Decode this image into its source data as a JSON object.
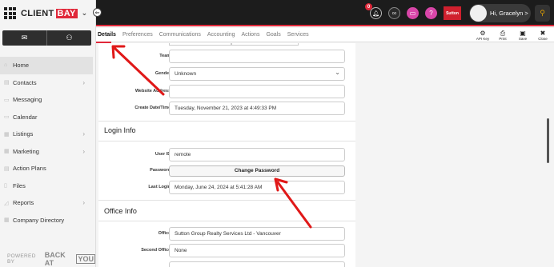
{
  "brand": {
    "name_part1": "CLIENT",
    "name_part2": "BAY"
  },
  "sidebar": {
    "tools": [
      {
        "icon": "envelope-icon",
        "glyph": "✉"
      },
      {
        "icon": "add-person-icon",
        "glyph": "👤"
      }
    ],
    "items": [
      {
        "label": "Home",
        "icon": "home-icon",
        "active": true,
        "has_arrow": false
      },
      {
        "label": "Contacts",
        "icon": "contacts-icon",
        "has_arrow": true
      },
      {
        "label": "Messaging",
        "icon": "chat-icon",
        "has_arrow": false
      },
      {
        "label": "Calendar",
        "icon": "calendar-icon",
        "has_arrow": false
      },
      {
        "label": "Listings",
        "icon": "listings-icon",
        "has_arrow": true
      },
      {
        "label": "Marketing",
        "icon": "marketing-icon",
        "has_arrow": true
      },
      {
        "label": "Action Plans",
        "icon": "action-plans-icon",
        "has_arrow": false
      },
      {
        "label": "Files",
        "icon": "files-icon",
        "has_arrow": false
      },
      {
        "label": "Reports",
        "icon": "reports-icon",
        "has_arrow": true
      },
      {
        "label": "Company Directory",
        "icon": "directory-icon",
        "has_arrow": false
      }
    ],
    "powered_by": "POWERED BY",
    "powered_brand": "BACK AT",
    "powered_brand_box": "YOU"
  },
  "topbar": {
    "notification_count": "0",
    "sutton_label": "Sutton",
    "user_greeting": "Hi, Gracelyn >"
  },
  "tabs": [
    "Details",
    "Preferences",
    "Communications",
    "Accounting",
    "Actions",
    "Goals",
    "Services"
  ],
  "actions": [
    {
      "label": "API Key",
      "icon": "gear-icon",
      "glyph": "⚙"
    },
    {
      "label": "Print",
      "icon": "print-icon",
      "glyph": "🖶"
    },
    {
      "label": "Save",
      "icon": "save-icon",
      "glyph": "💾"
    },
    {
      "label": "Close",
      "icon": "close-icon",
      "glyph": "✖"
    }
  ],
  "form": {
    "team_label": "Team:",
    "team_value": "",
    "gender_label": "Gender:",
    "gender_value": "Unknown",
    "website_label": "Website Address:",
    "website_value": "",
    "created_label": "Create Date/Time:",
    "created_value": "Tuesday, November 21, 2023 at 4:49:33 PM",
    "login_section": "Login Info",
    "userid_label": "User ID:",
    "userid_value": "remote",
    "password_label": "Password:",
    "change_password": "Change Password",
    "lastlogin_label": "Last Login:",
    "lastlogin_value": "Monday, June 24, 2024 at 5:41:28 AM",
    "office_section": "Office Info",
    "office_label": "Office:",
    "office_value": "Sutton Group Realty Services Ltd - Vancouver",
    "second_office_label": "Second Office:",
    "second_office_value": "None"
  },
  "colors": {
    "accent": "#e0283a",
    "arrow": "#e01818",
    "pink": "#d946a8"
  }
}
